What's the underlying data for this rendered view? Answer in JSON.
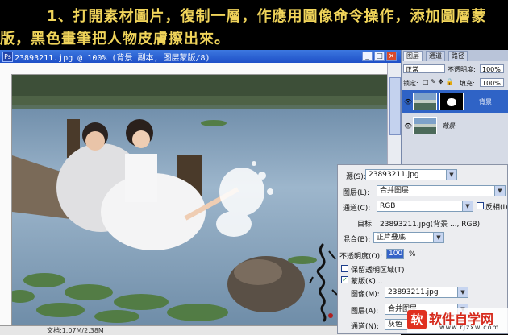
{
  "caption": {
    "line1": "1、打開素材圖片，復制一層，作應用圖像命令操作，添加圖層蒙",
    "line2": "版，黑色畫筆把人物皮膚擦出來。"
  },
  "document": {
    "title": "23893211.jpg @ 100% (背景 副本, 图层蒙版/8)",
    "status": "文档:1.07M/2.38M"
  },
  "layers_panel": {
    "tabs": [
      "图层",
      "通道",
      "路径"
    ],
    "blend_mode": "正常",
    "opacity_label": "不透明度:",
    "opacity_value": "100%",
    "lock_label": "锁定:",
    "fill_label": "填充:",
    "fill_value": "100%",
    "layers": [
      {
        "name": "背景",
        "selected": true,
        "has_mask": true
      },
      {
        "name": "背景",
        "selected": false,
        "has_mask": false
      }
    ]
  },
  "apply_image_dialog": {
    "source_label": "源(S):",
    "source_value": "23893211.jpg",
    "layer_label": "图层(L):",
    "layer_value": "合并图层",
    "channel_label": "通道(C):",
    "channel_value": "RGB",
    "invert_label": "反相(I)",
    "target_label": "目标:",
    "target_value": "23893211.jpg(背景 ..., RGB)",
    "blending_label": "混合(B):",
    "blending_value": "正片叠底",
    "opacity_label": "不透明度(O):",
    "opacity_value": "100",
    "opacity_unit": "%",
    "preserve_label": "保留透明区域(T)",
    "mask_label": "蒙版(K)...",
    "mask_checked": true,
    "image_label": "图像(M):",
    "image_value": "23893211.jpg",
    "mask_layer_label": "图层(A):",
    "mask_layer_value": "合并图层",
    "mask_channel_label": "通道(N):",
    "mask_channel_value": "灰色"
  },
  "watermark": {
    "logo": "软",
    "name": "软件自学网",
    "url": "www.rjzxw.com"
  },
  "colors": {
    "caption_text": "#f0d45a",
    "titlebar": "#2a5fd6",
    "selected_layer": "#2f63c6"
  }
}
